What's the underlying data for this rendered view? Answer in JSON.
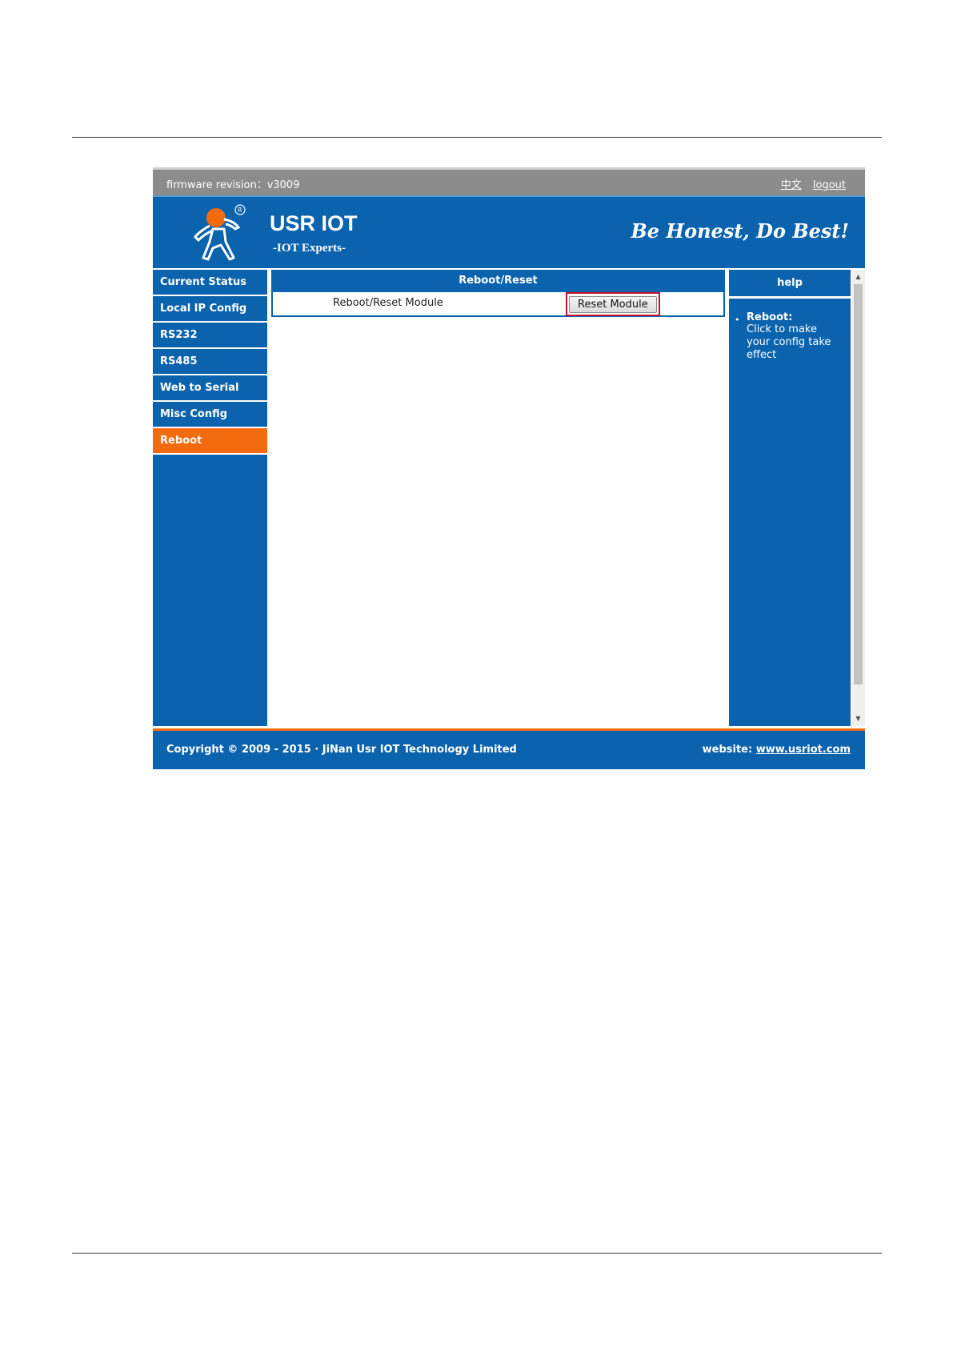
{
  "topbar": {
    "firmware": "firmware revision：v3009",
    "lang_link": "中文",
    "logout_link": "logout"
  },
  "header": {
    "brand": "USR IOT",
    "subtitle": "-IOT Experts-",
    "slogan": "Be Honest, Do Best!",
    "logo_registered": "®"
  },
  "sidebar": {
    "items": [
      {
        "label": "Current Status"
      },
      {
        "label": "Local IP Config"
      },
      {
        "label": "RS232"
      },
      {
        "label": "RS485"
      },
      {
        "label": "Web to Serial"
      },
      {
        "label": "Misc Config"
      },
      {
        "label": "Reboot"
      }
    ],
    "active_index": 6
  },
  "main": {
    "title": "Reboot/Reset",
    "row_label": "Reboot/Reset Module",
    "button_label": "Reset Module"
  },
  "help": {
    "title": "help",
    "bullet": "•",
    "heading": "Reboot:",
    "description": "Click to make your config take effect"
  },
  "footer": {
    "copyright": "Copyright © 2009 - 2015 · JiNan Usr IOT Technology Limited",
    "website_label": "website:",
    "website_link": "www.usriot.com"
  },
  "colors": {
    "primary_blue": "#0b63ae",
    "accent_orange": "#f26b0f",
    "highlight_red": "#c8102e",
    "topbar_gray": "#8c8c8c"
  },
  "icons": {
    "logo": "running-person-logo-icon",
    "scroll_up": "scroll-up-arrow-icon",
    "scroll_down": "scroll-down-arrow-icon"
  }
}
